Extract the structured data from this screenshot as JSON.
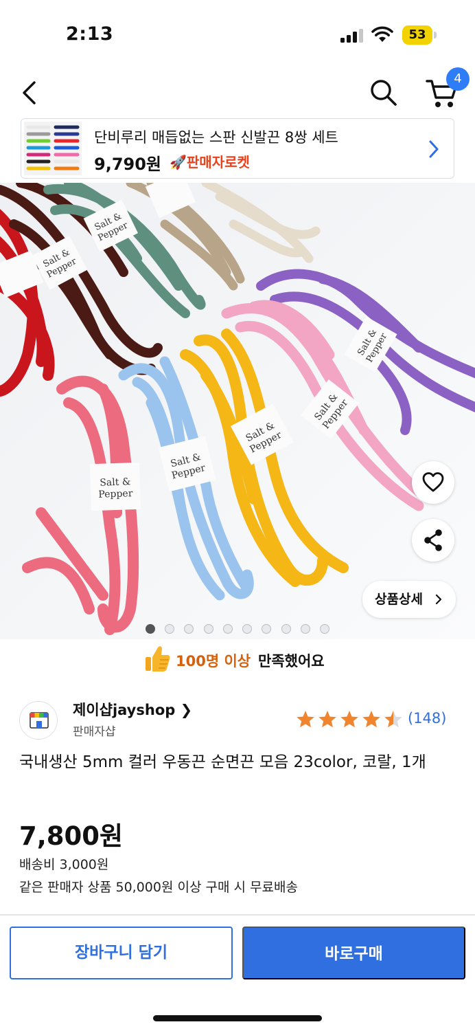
{
  "status_bar": {
    "time": "2:13",
    "battery_level": "53"
  },
  "nav": {
    "cart_count": "4"
  },
  "promo": {
    "title": "단비루리 매듭없는 스판 신발끈 8쌍 세트",
    "price": "9,790원",
    "badge_label": "판매자로켓"
  },
  "product_image": {
    "detail_label": "상품상세",
    "brand_tag_line1": "Salt &",
    "brand_tag_line2": "Pepper",
    "slide_count": 10,
    "active_slide": 1
  },
  "satisfaction": {
    "count": "100명 이상",
    "text": "만족했어요"
  },
  "seller": {
    "name": "제이샵jayshop",
    "type": "판매자샵"
  },
  "rating": {
    "stars": 4.5,
    "review_count": "(148)"
  },
  "product": {
    "title": "국내생산 5mm 컬러 우동끈 순면끈 모음 23color, 코랄, 1개",
    "price": "7,800원",
    "shipping_fee": "배송비 3,000원",
    "shipping_note": "같은 판매자 상품 50,000원 이상 구매 시 무료배송"
  },
  "actions": {
    "add_to_cart": "장바구니 담기",
    "buy_now": "바로구매"
  },
  "colors": {
    "accent": "#2f6fe0",
    "badge": "#2f7df6",
    "rocket": "#e9411c",
    "satisfaction": "#d6610d",
    "star": "#f0852d"
  }
}
